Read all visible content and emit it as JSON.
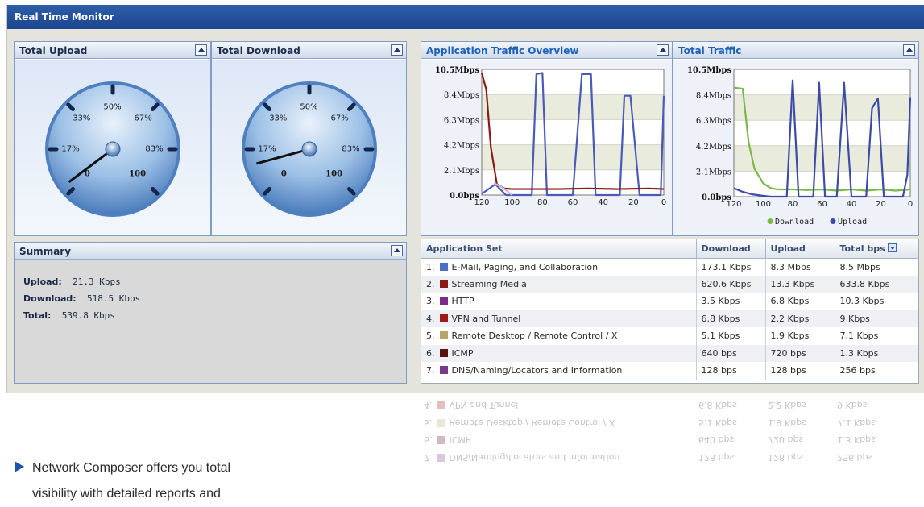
{
  "window": {
    "title": "Real Time Monitor"
  },
  "panels": {
    "upload": {
      "title": "Total Upload"
    },
    "download": {
      "title": "Total Download"
    },
    "app_traffic": {
      "title": "Application Traffic Overview"
    },
    "total_traffic": {
      "title": "Total Traffic"
    },
    "summary": {
      "title": "Summary"
    }
  },
  "gauges": {
    "labels": [
      "0",
      "17%",
      "33%",
      "50%",
      "67%",
      "83%",
      "100"
    ],
    "upload_needle_fraction": 0.03,
    "download_needle_fraction": 0.11
  },
  "summary": {
    "upload_label": "Upload:",
    "upload_value": "21.3 Kbps",
    "download_label": "Download:",
    "download_value": "518.5 Kbps",
    "total_label": "Total:",
    "total_value": "539.8 Kbps"
  },
  "chart_data": [
    {
      "type": "line",
      "title": "Application Traffic Overview",
      "y_ticks": [
        "10.5Mbps",
        "8.4Mbps",
        "6.3Mbps",
        "4.2Mbps",
        "2.1Mbps",
        "0.0bps"
      ],
      "x_ticks": [
        "120",
        "100",
        "80",
        "60",
        "40",
        "20",
        "0"
      ],
      "ylim": [
        0,
        10.5
      ],
      "xlim": [
        120,
        0
      ],
      "series": [
        {
          "color": "#4a5ab8",
          "x": [
            120,
            111,
            104,
            97,
            94,
            90,
            87,
            84,
            80,
            77,
            72,
            69,
            66,
            60,
            54,
            51,
            48,
            45,
            40,
            32,
            29,
            26,
            24,
            22,
            16,
            12,
            8,
            5,
            2,
            0
          ],
          "y": [
            0.1,
            0.9,
            0,
            0,
            0,
            0,
            0,
            10.1,
            10.2,
            0,
            0,
            0,
            0,
            0,
            10.1,
            10.1,
            10.1,
            0,
            0,
            0,
            0,
            8.3,
            8.3,
            8.3,
            0,
            0,
            0,
            0,
            0,
            8.3
          ]
        },
        {
          "color": "#8a1a14",
          "x": [
            120,
            117,
            114,
            110,
            105,
            100,
            90,
            70,
            50,
            30,
            10,
            0
          ],
          "y": [
            10.2,
            8.8,
            4.0,
            0.9,
            0.55,
            0.5,
            0.5,
            0.5,
            0.55,
            0.5,
            0.55,
            0.5
          ]
        },
        {
          "color": "#c8c0d8",
          "x": [
            112,
            106,
            102,
            100
          ],
          "y": [
            1.0,
            0.6,
            0.2,
            0.0
          ]
        }
      ]
    },
    {
      "type": "line",
      "title": "Total Traffic",
      "y_ticks": [
        "10.5Mbps",
        "8.4Mbps",
        "6.3Mbps",
        "4.2Mbps",
        "2.1Mbps",
        "0.0bps"
      ],
      "x_ticks": [
        "120",
        "100",
        "80",
        "60",
        "40",
        "20",
        "0"
      ],
      "ylim": [
        0,
        10.5
      ],
      "xlim": [
        120,
        0
      ],
      "legend": [
        "Download",
        "Upload"
      ],
      "series": [
        {
          "name": "Download",
          "color": "#7bb84a",
          "x": [
            120,
            114,
            110,
            106,
            100,
            95,
            90,
            80,
            70,
            60,
            50,
            40,
            30,
            20,
            10,
            0
          ],
          "y": [
            9.0,
            8.9,
            4.5,
            2.3,
            1.1,
            0.7,
            0.6,
            0.6,
            0.55,
            0.6,
            0.5,
            0.6,
            0.5,
            0.6,
            0.5,
            0.6
          ]
        },
        {
          "name": "Upload",
          "color": "#3c4aa8",
          "x": [
            120,
            114,
            108,
            102,
            95,
            88,
            84,
            80,
            76,
            70,
            66,
            62,
            58,
            54,
            50,
            45,
            40,
            35,
            30,
            26,
            22,
            18,
            12,
            8,
            5,
            2,
            0
          ],
          "y": [
            0.7,
            0.4,
            0.2,
            0.1,
            0,
            0,
            0,
            9.6,
            0,
            0,
            0,
            9.4,
            0,
            0,
            0,
            9.4,
            0,
            0,
            0,
            7.3,
            8.1,
            0,
            0,
            0,
            0,
            1.8,
            8.2
          ]
        }
      ]
    }
  ],
  "table": {
    "headers": [
      "Application Set",
      "Download",
      "Upload",
      "Total bps"
    ],
    "rows": [
      {
        "n": "1.",
        "color": "#4a70c8",
        "name": "E-Mail, Paging, and Collaboration",
        "down": "173.1 Kbps",
        "up": "8.3 Mbps",
        "total": "8.5 Mbps"
      },
      {
        "n": "2.",
        "color": "#8a1a14",
        "name": "Streaming Media",
        "down": "620.6 Kbps",
        "up": "13.3 Kbps",
        "total": "633.8 Kbps"
      },
      {
        "n": "3.",
        "color": "#7a2a8a",
        "name": "HTTP",
        "down": "3.5 Kbps",
        "up": "6.8 Kbps",
        "total": "10.3 Kbps"
      },
      {
        "n": "4.",
        "color": "#a01818",
        "name": "VPN and Tunnel",
        "down": "6.8 Kbps",
        "up": "2.2 Kbps",
        "total": "9 Kbps"
      },
      {
        "n": "5.",
        "color": "#b8a468",
        "name": "Remote Desktop / Remote Control / X",
        "down": "5.1 Kbps",
        "up": "1.9 Kbps",
        "total": "7.1 Kbps"
      },
      {
        "n": "6.",
        "color": "#5a1010",
        "name": "ICMP",
        "down": "640 bps",
        "up": "720 bps",
        "total": "1.3 Kbps"
      },
      {
        "n": "7.",
        "color": "#7a3a8a",
        "name": "DNS/Naming/Locators and Information",
        "down": "128 bps",
        "up": "128 bps",
        "total": "256 bps"
      }
    ]
  },
  "caption": {
    "line1": "Network Composer offers you total",
    "line2": "visibility with detailed reports and"
  }
}
